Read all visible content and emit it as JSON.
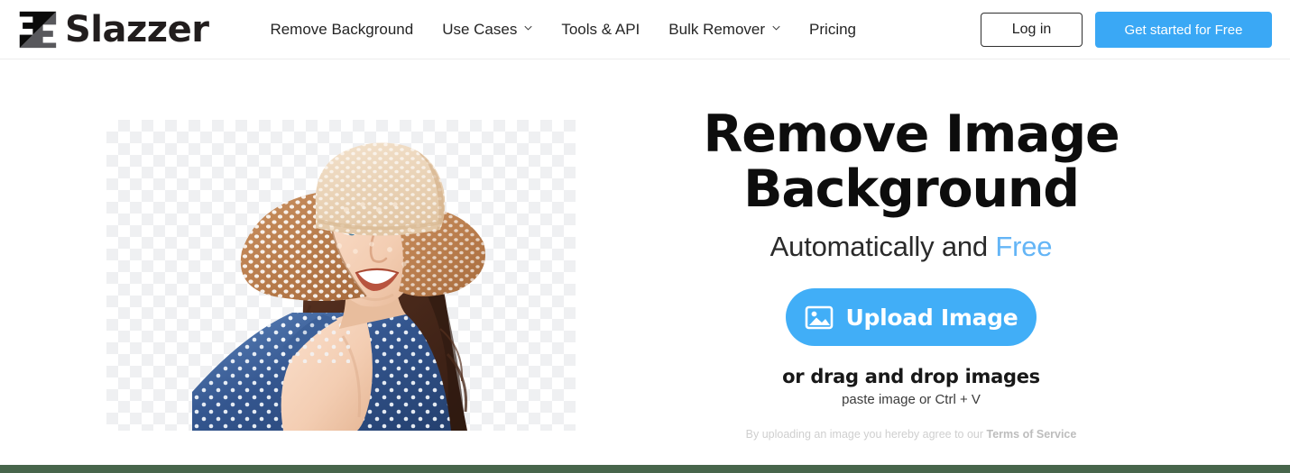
{
  "header": {
    "brand_name": "Slazzer",
    "brand_icon": "slazzer-logo-icon",
    "nav": [
      {
        "label": "Remove Background",
        "has_dropdown": false
      },
      {
        "label": "Use Cases",
        "has_dropdown": true
      },
      {
        "label": "Tools & API",
        "has_dropdown": false
      },
      {
        "label": "Bulk Remover",
        "has_dropdown": true
      },
      {
        "label": "Pricing",
        "has_dropdown": false
      }
    ],
    "login_label": "Log in",
    "get_started_label": "Get started for Free"
  },
  "main": {
    "preview": {
      "alt": "Smiling woman wearing a wide-brim straw hat and blue polka-dot top on transparent checkerboard background"
    },
    "headline_line1": "Remove Image",
    "headline_line2": "Background",
    "subhead_prefix": "Automatically and ",
    "subhead_accent": "Free",
    "upload_button_label": "Upload Image",
    "upload_button_icon": "picture-icon",
    "drag_text": "or drag and drop images",
    "paste_text": "paste image or Ctrl + V",
    "tos_prefix": "By uploading an image you hereby agree to our ",
    "tos_link": "Terms of Service"
  },
  "colors": {
    "accent_blue": "#3aa8f5",
    "upload_blue": "#41aef7",
    "free_blue": "#64b5f6",
    "footer_green": "#47654b",
    "header_border": "#ececec",
    "checker_gray": "#eff0f2",
    "text_dark": "#0d0d0d",
    "tos_gray": "#cfcfcf"
  }
}
